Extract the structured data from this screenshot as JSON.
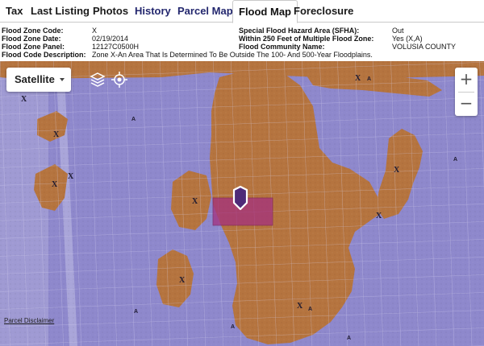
{
  "tabs": [
    {
      "label": "Tax",
      "active": false
    },
    {
      "label": "Last Listing",
      "active": false
    },
    {
      "label": "Photos",
      "active": false
    },
    {
      "label": "History",
      "active": false
    },
    {
      "label": "Parcel Map",
      "active": false
    },
    {
      "label": "Flood Map",
      "active": true
    },
    {
      "label": "Foreclosure",
      "active": false
    }
  ],
  "flood_info": {
    "zone_code": {
      "label": "Flood Zone Code:",
      "value": "X"
    },
    "zone_date": {
      "label": "Flood Zone Date:",
      "value": "02/19/2014"
    },
    "zone_panel": {
      "label": "Flood Zone Panel:",
      "value": "12127C0500H"
    },
    "description": {
      "label": "Flood Code Description:",
      "value": "Zone X-An Area That Is Determined To Be Outside The 100- And 500-Year Floodplains."
    },
    "sfha": {
      "label": "Special Flood Hazard Area (SFHA):",
      "value": "Out"
    },
    "within_250": {
      "label": "Within 250 Feet of Multiple Flood Zone:",
      "value": "Yes (X,A)"
    },
    "community": {
      "label": "Flood Community Name:",
      "value": "VOLUSIA COUNTY"
    }
  },
  "map": {
    "map_type": "Satellite",
    "zoom_in": "+",
    "zoom_out": "−",
    "disclaimer": "Parcel Disclaimer",
    "zone_x_color": "#b5743f",
    "zone_a_color": "#8e88cc",
    "highlight_color": "#a4307e",
    "marker_color": "#4e2a78",
    "zone_labels": {
      "x": "X",
      "a": "A"
    },
    "icons": [
      "layers-icon",
      "locate-icon",
      "map-marker-icon"
    ]
  }
}
